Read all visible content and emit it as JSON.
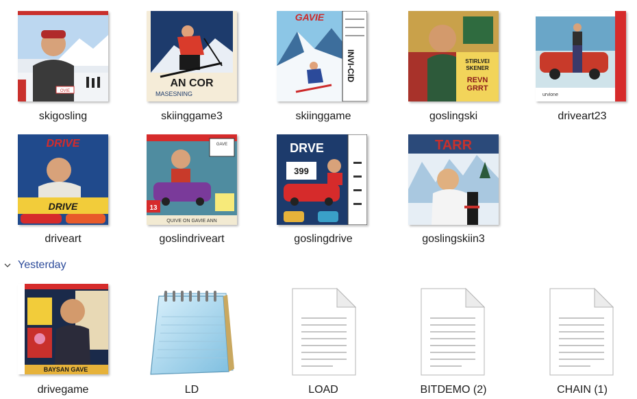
{
  "row1": [
    {
      "name": "skigosling"
    },
    {
      "name": "skiinggame3"
    },
    {
      "name": "skiinggame"
    },
    {
      "name": "goslingski"
    },
    {
      "name": "driveart23"
    }
  ],
  "row2": [
    {
      "name": "driveart"
    },
    {
      "name": "goslindriveart"
    },
    {
      "name": "goslingdrive"
    },
    {
      "name": "goslingskiin3"
    }
  ],
  "group_header": {
    "label": "Yesterday"
  },
  "row3": [
    {
      "name": "drivegame",
      "icon": "image-thumbnail"
    },
    {
      "name": "LD",
      "icon": "notepad-icon"
    },
    {
      "name": "LOAD",
      "icon": "text-file-icon"
    },
    {
      "name": "BITDEMO (2)",
      "icon": "text-file-icon"
    },
    {
      "name": "CHAIN (1)",
      "icon": "text-file-icon"
    }
  ],
  "thumb_text": {
    "skiinggame3_line1": "AN COR",
    "skiinggame3_line2": "MASESNING",
    "skiinggame_title": "GAVIE",
    "skiinggame_side": "INVI-CID",
    "goslingski_l1": "STIRLVEI",
    "goslingski_l2": "SKENER",
    "goslingski_l3": "REVN",
    "goslingski_l4": "GRRT",
    "driveart23_caption": "urvione",
    "driveart_title": "DRIVE",
    "driveart_bottom": "DRIVE",
    "goslindriveart_top": "GAVE",
    "goslindriveart_num": "13",
    "goslindriveart_bottom": "QUIVE ON GAVIE ANN",
    "goslingdrive_title": "DRVE",
    "goslingdrive_num": "399",
    "goslingskiin3_title": "TARR",
    "drivegame_caption": "BAYSAN GAVE",
    "skigosling_logo": "OVIE"
  },
  "colors": {
    "accent": "#2b4a9a",
    "label": "#1a1a1a"
  }
}
